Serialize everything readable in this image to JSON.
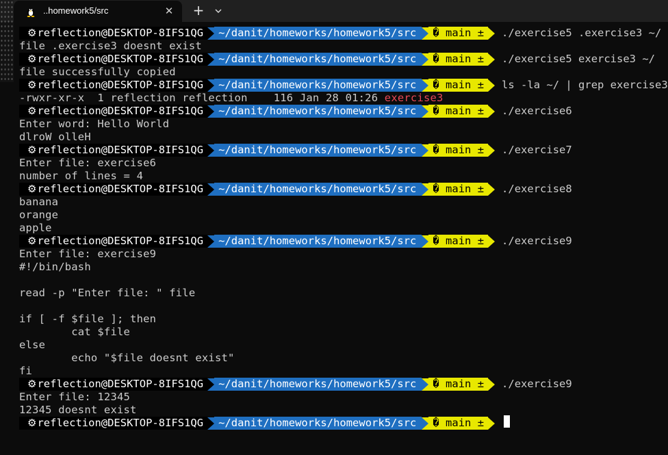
{
  "tab": {
    "title": "..homework5/src",
    "icon": "linux-penguin-icon",
    "close_label": "✕",
    "new_tab_label": "+"
  },
  "prompt": {
    "user": "reflection@DESKTOP-8IFS1QG",
    "path": "~/danit/homeworks/homework5/src",
    "git": "� main ±"
  },
  "colors": {
    "background": "#0c0c0c",
    "text": "#cccccc",
    "path_segment": "#1f6fc1",
    "git_segment": "#e8e800",
    "highlight_red": "#e74856"
  },
  "terminal": {
    "cmd1": "./exercise5 .exercise3 ~/",
    "out1": "file .exercise3 doesnt exist",
    "cmd2": "./exercise5 exercise3 ~/",
    "out2": "file successfully copied",
    "cmd3": "ls -la ~/ | grep exercise3",
    "out3_prefix": "-rwxr-xr-x  1 reflection reflection    116 Jan 28 01:26 ",
    "out3_file": "exercise3",
    "cmd4": "./exercise6",
    "out4a": "Enter word: Hello World",
    "out4b": "dlroW olleH",
    "cmd5": "./exercise7",
    "out5a": "Enter file: exercise6",
    "out5b": "number of lines = 4",
    "cmd6": "./exercise8",
    "out6a": "banana",
    "out6b": "orange",
    "out6c": "apple",
    "cmd7": "./exercise9",
    "out7a": "Enter file: exercise9",
    "out7b": "#!/bin/bash",
    "out7c": "read -p \"Enter file: \" file",
    "out7d": "if [ -f $file ]; then",
    "out7e": "        cat $file",
    "out7f": "else",
    "out7g": "        echo \"$file doesnt exist\"",
    "out7h": "fi",
    "cmd8": "./exercise9",
    "out8a": "Enter file: 12345",
    "out8b": "12345 doesnt exist"
  }
}
